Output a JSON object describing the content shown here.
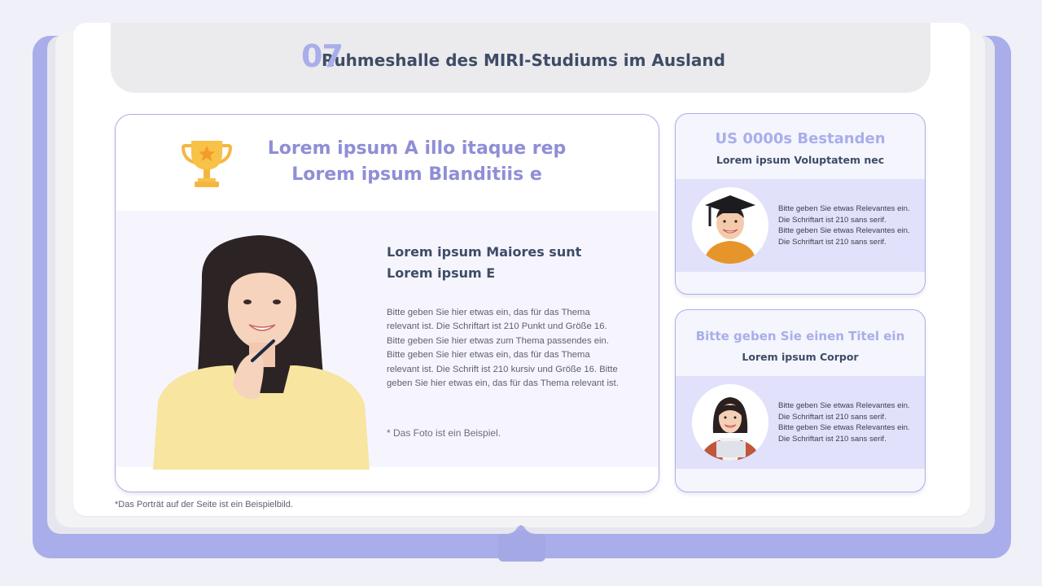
{
  "header": {
    "number": "07",
    "title": "Ruhmeshalle des MIRI-Studiums im Ausland"
  },
  "main_card": {
    "title_line1": "Lorem ipsum A illo itaque rep",
    "title_line2": "Lorem ipsum Blanditiis e",
    "subtitle_line1": "Lorem ipsum Maiores sunt",
    "subtitle_line2": "Lorem ipsum E",
    "body_lines": [
      "Bitte geben Sie hier etwas ein, das für das Thema",
      "relevant ist. Die Schriftart ist 210 Punkt und Größe 16.",
      "Bitte geben Sie hier etwas zum Thema passendes ein.",
      "Bitte geben Sie hier etwas ein, das für das Thema",
      "relevant ist. Die Schrift ist 210 kursiv und Größe 16. Bitte",
      "geben Sie hier etwas ein, das für das Thema relevant ist."
    ],
    "note": "* Das Foto ist ein Beispiel."
  },
  "side_cards": [
    {
      "title": "US 0000s Bestanden",
      "subtitle": "Lorem ipsum Voluptatem nec",
      "text_lines": [
        "Bitte geben Sie etwas Relevantes ein.",
        "Die Schriftart ist 210 sans serif.",
        "Bitte geben Sie etwas Relevantes ein.",
        "Die Schriftart ist 210 sans serif."
      ]
    },
    {
      "title": "Bitte geben Sie einen Titel ein",
      "subtitle": "Lorem ipsum Corpor",
      "text_lines": [
        "Bitte geben Sie etwas Relevantes ein.",
        "Die Schriftart ist 210 sans serif.",
        "Bitte geben Sie etwas Relevantes ein.",
        "Die Schriftart ist 210 sans serif."
      ]
    }
  ],
  "footnote": "*Das Porträt auf der Seite ist ein Beispielbild.",
  "colors": {
    "accent": "#a9aeea",
    "title_purple": "#8f8ed6",
    "navy": "#3e4c66",
    "band": "#e1e1fb"
  },
  "icons": [
    "trophy-icon"
  ]
}
